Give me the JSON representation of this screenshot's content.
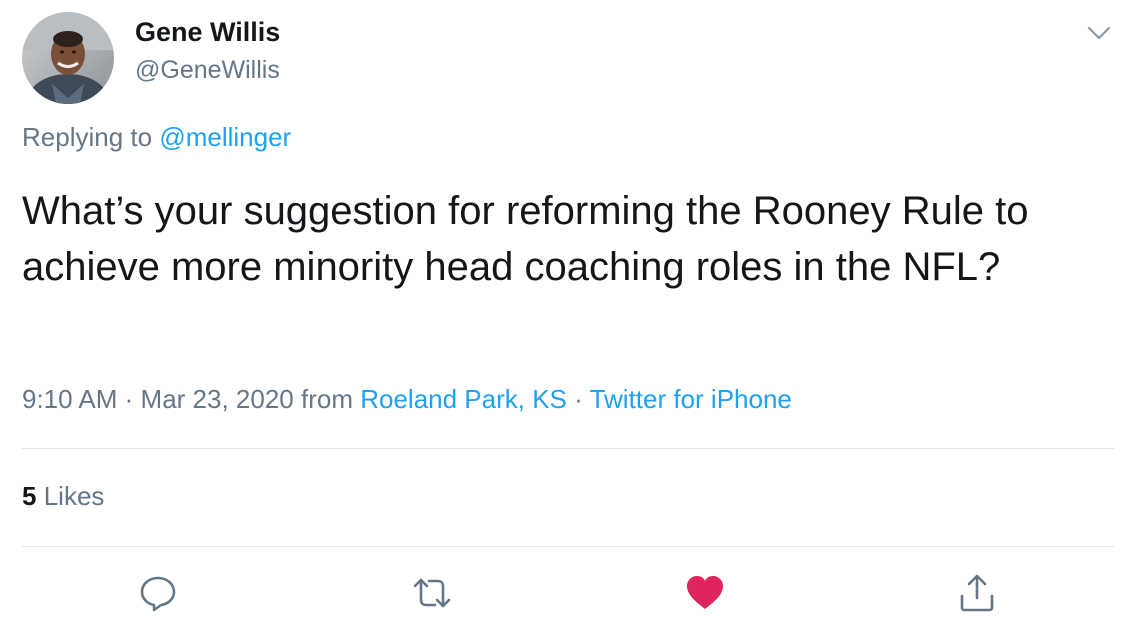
{
  "author": {
    "display_name": "Gene Willis",
    "handle": "@GeneWillis",
    "avatar_icon": "user-avatar-photo"
  },
  "reply_context": {
    "prefix": "Replying to",
    "mention": "@mellinger"
  },
  "tweet": {
    "text": "What’s your suggestion for reforming the Rooney Rule to achieve more minority head coaching roles in the NFL?"
  },
  "meta": {
    "time": "9:10 AM",
    "separator": "·",
    "date": "Mar 23, 2020",
    "from_label": "from",
    "location": "Roeland Park, KS",
    "source": "Twitter for iPhone"
  },
  "stats": {
    "likes_count": "5",
    "likes_label": "Likes"
  },
  "actions": {
    "reply_icon": "reply-icon",
    "retweet_icon": "retweet-icon",
    "like_icon": "heart-icon",
    "share_icon": "share-icon"
  },
  "colors": {
    "text_primary": "#14171a",
    "text_secondary": "#657786",
    "link": "#1da1f2",
    "like_active": "#e0245e",
    "divider": "#e1e8ed"
  }
}
